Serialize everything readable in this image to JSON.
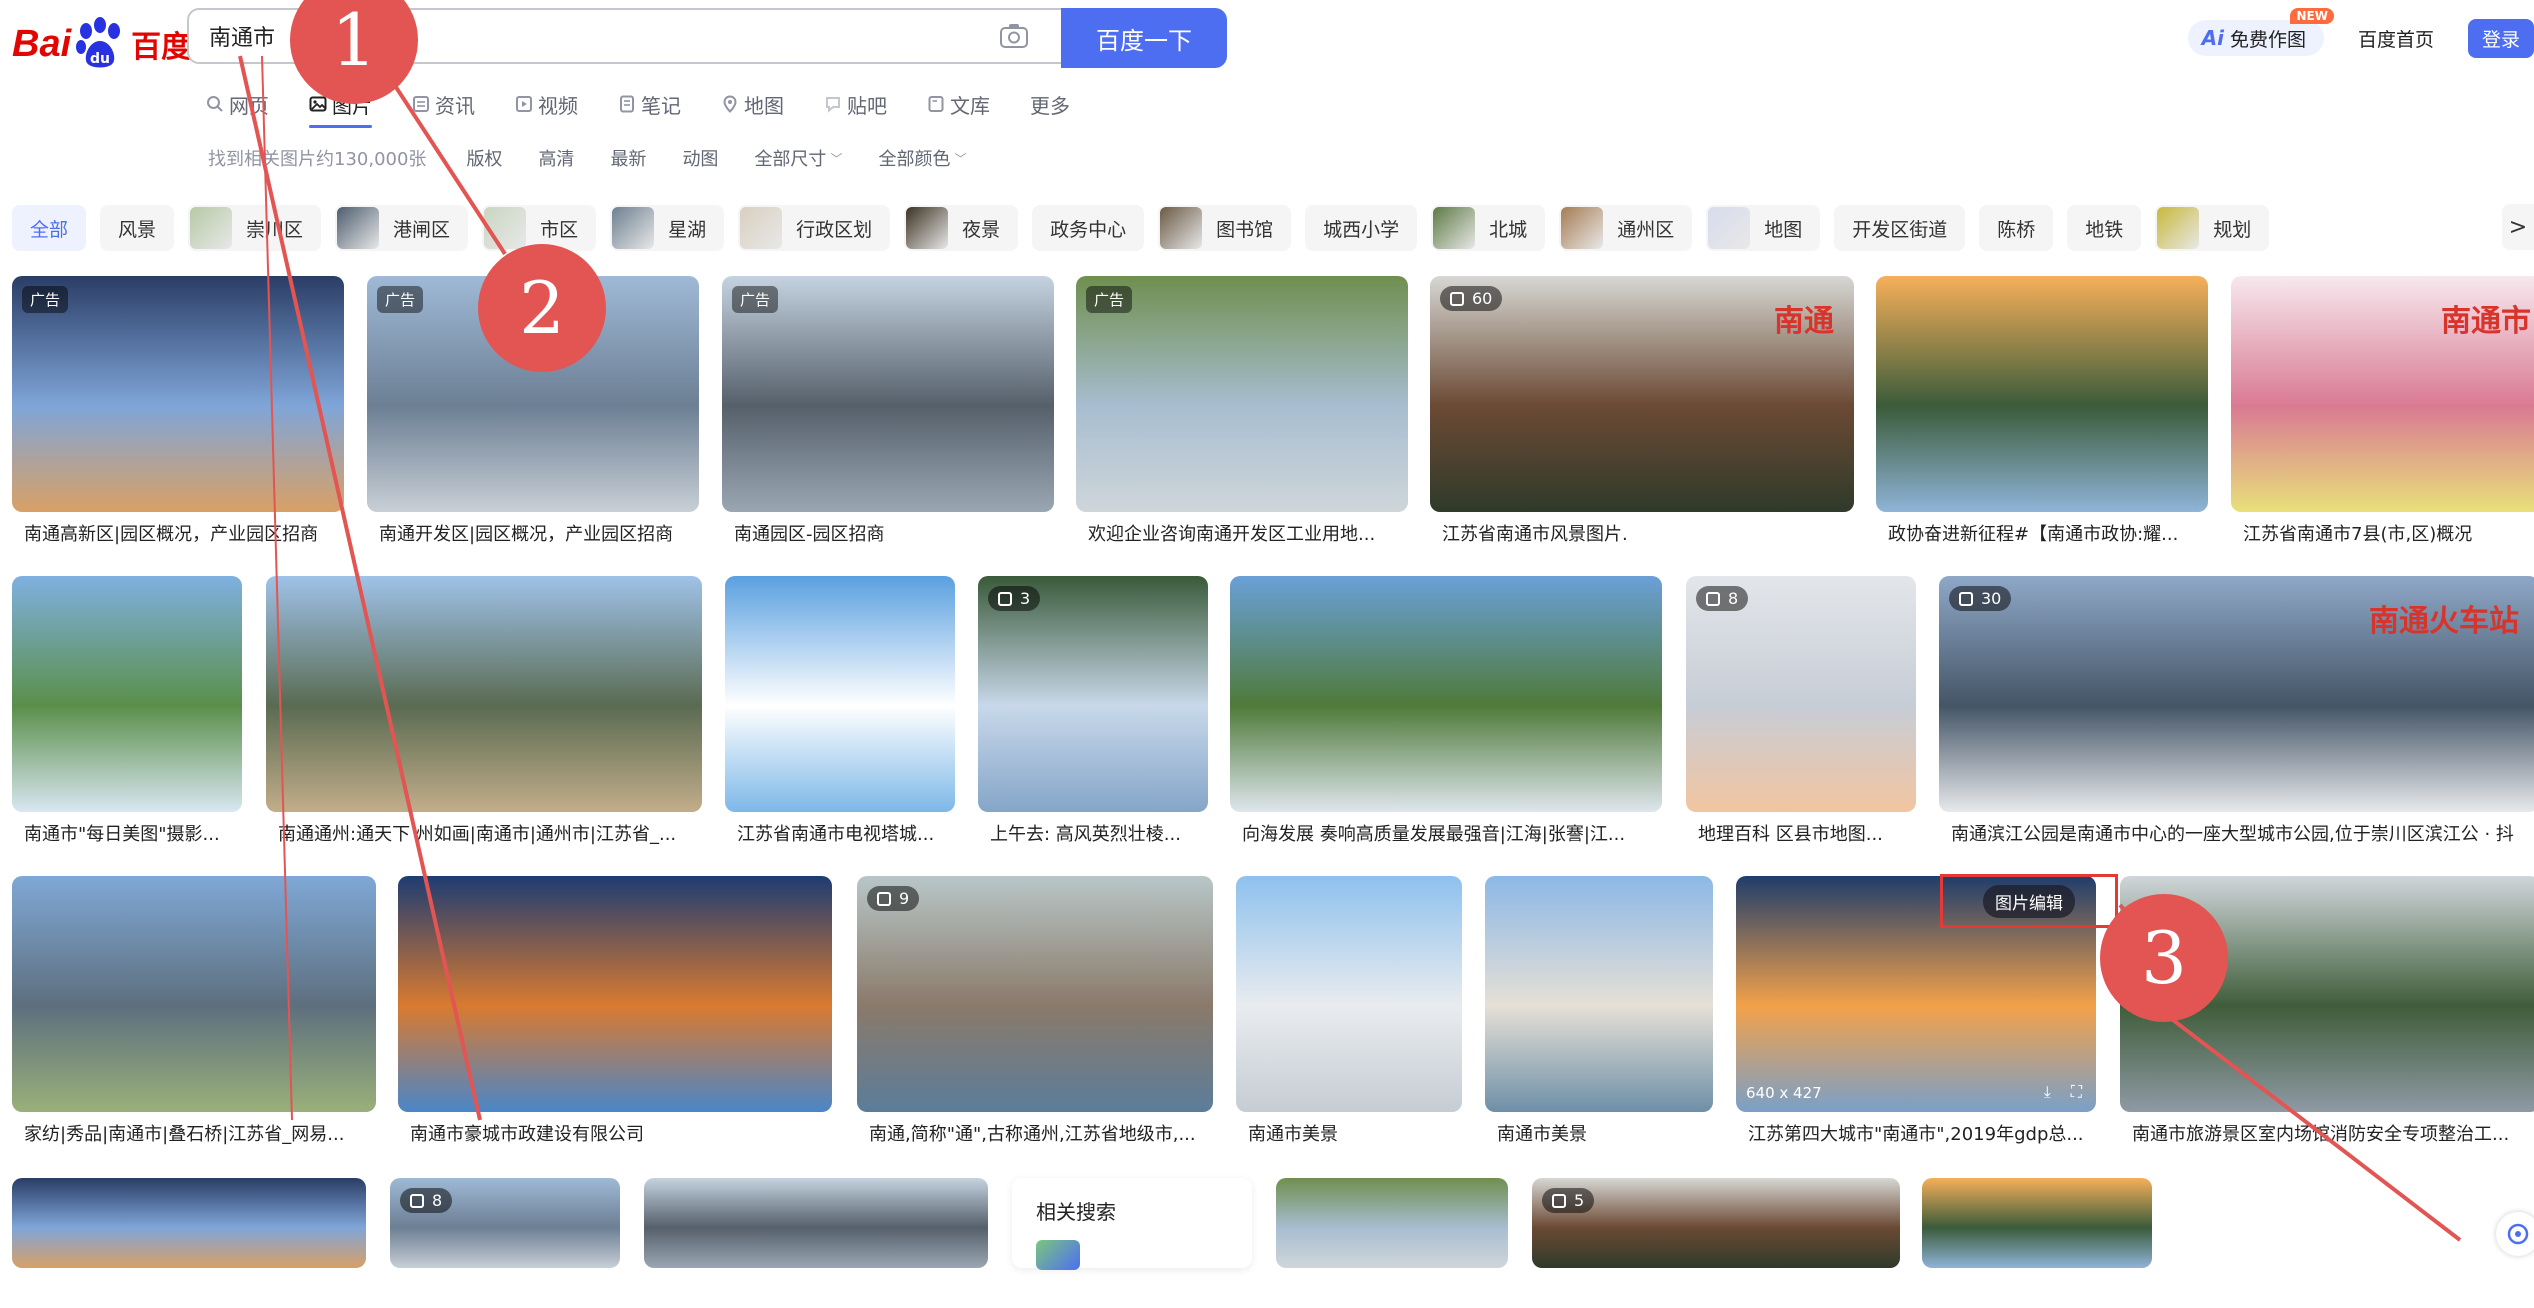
{
  "header": {
    "logo_bai": "Bai",
    "logo_du": "du",
    "logo_cn": "百度",
    "search_value": "南通市",
    "search_button": "百度一下",
    "ai_button": "免费作图",
    "ai_mark": "Ai",
    "new_badge": "NEW",
    "home_link": "百度首页",
    "login": "登录"
  },
  "tabs": [
    {
      "label": "网页"
    },
    {
      "label": "图片",
      "active": true
    },
    {
      "label": "资讯"
    },
    {
      "label": "视频"
    },
    {
      "label": "笔记"
    },
    {
      "label": "地图"
    },
    {
      "label": "贴吧"
    },
    {
      "label": "文库"
    },
    {
      "label": "更多"
    }
  ],
  "filters": {
    "found_text": "找到相关图片约130,000张",
    "items": [
      "版权",
      "高清",
      "最新",
      "动图",
      "全部尺寸",
      "全部颜色"
    ]
  },
  "chips": [
    "全部",
    "风景",
    "崇川区",
    "港闸区",
    "市区",
    "星湖",
    "行政区划",
    "夜景",
    "政务中心",
    "图书馆",
    "城西小学",
    "北城",
    "通州区",
    "地图",
    "开发区街道",
    "陈桥",
    "地铁",
    "规划"
  ],
  "chip_next": ">",
  "row1": [
    {
      "caption": "南通高新区|园区概况，产业园区招商",
      "badge": "广告"
    },
    {
      "caption": "南通开发区|园区概况，产业园区招商",
      "badge": "广告"
    },
    {
      "caption": "南通园区-园区招商",
      "badge": "广告"
    },
    {
      "caption": "欢迎企业咨询南通开发区工业用地...",
      "badge": "广告"
    },
    {
      "caption": "江苏省南通市风景图片.",
      "count": "60",
      "overlay_text": "南通"
    },
    {
      "caption": "政协奋进新征程#【南通市政协:耀..."
    },
    {
      "caption": "江苏省南通市7县(市,区)概况",
      "overlay_text": "南通市"
    }
  ],
  "row2": [
    {
      "caption": "南通市\"每日美图\"摄影..."
    },
    {
      "caption": "南通通州:通天下 州如画|南通市|通州市|江苏省_..."
    },
    {
      "caption": "江苏省南通市电视塔城..."
    },
    {
      "caption": "上午去: 高风英烈壮棱...",
      "count": "3"
    },
    {
      "caption": "向海发展 奏响高质量发展最强音|江海|张謇|江..."
    },
    {
      "caption": "地理百科 区县市地图...",
      "count": "8"
    },
    {
      "caption": "南通滨江公园是南通市中心的一座大型城市公园,位于崇川区滨江公 · 抖",
      "count": "30",
      "overlay_text": "南通火车站"
    }
  ],
  "row3": [
    {
      "caption": "家纺|秀品|南通市|叠石桥|江苏省_网易..."
    },
    {
      "caption": "南通市豪城市政建设有限公司"
    },
    {
      "caption": "南通,简称\"通\",古称通州,江苏省地级市,...",
      "count": "9"
    },
    {
      "caption": "南通市美景"
    },
    {
      "caption": "南通市美景"
    },
    {
      "caption": "江苏第四大城市\"南通市\",2019年gdp总...",
      "size": "640 x 427",
      "ai_edit": "图片编辑"
    },
    {
      "caption": "南通市旅游景区室内场馆消防安全专项整治工..."
    }
  ],
  "row4": [
    {
      "count": ""
    },
    {
      "count": "8"
    },
    {},
    {},
    {},
    {
      "count": "5"
    },
    {}
  ],
  "related": {
    "title": "相关搜索"
  },
  "annotations": [
    "1",
    "2",
    "3"
  ]
}
